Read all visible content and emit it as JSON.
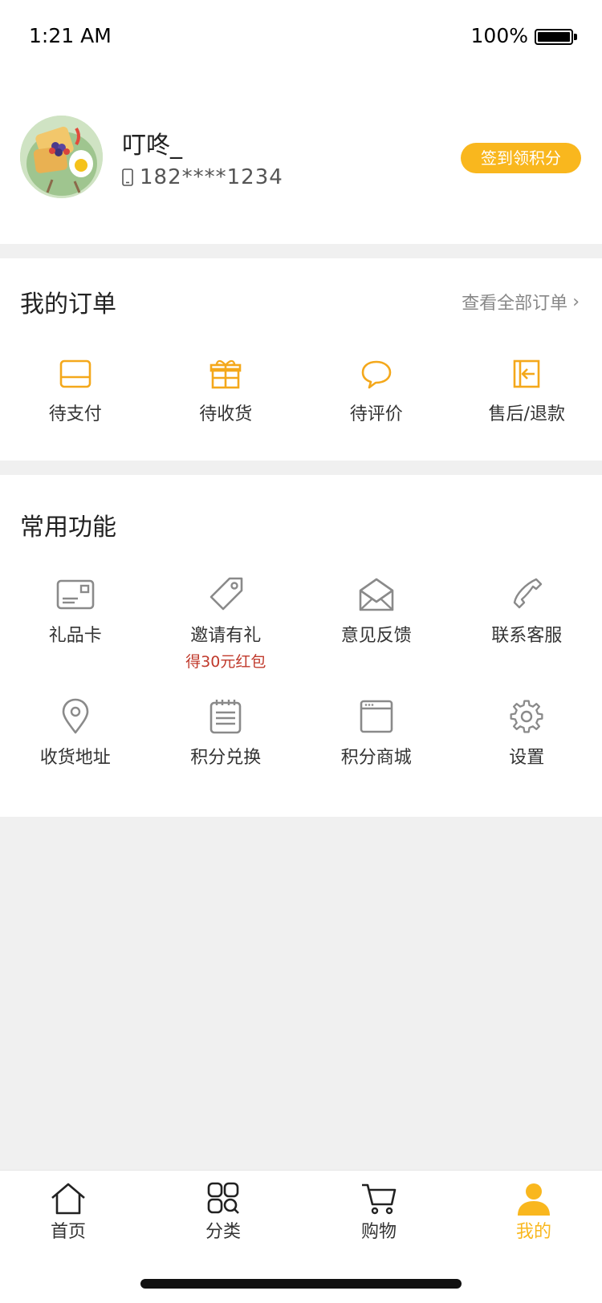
{
  "status_bar": {
    "time": "1:21 AM",
    "battery": "100%"
  },
  "profile": {
    "username": "叮咚_",
    "phone": "182****1234",
    "checkin_label": "签到领积分"
  },
  "orders": {
    "title": "我的订单",
    "view_all": "查看全部订单",
    "items": [
      {
        "label": "待支付",
        "icon": "wallet-icon"
      },
      {
        "label": "待收货",
        "icon": "gift-box-icon"
      },
      {
        "label": "待评价",
        "icon": "chat-bubble-icon"
      },
      {
        "label": "售后/退款",
        "icon": "return-icon"
      }
    ]
  },
  "features": {
    "title": "常用功能",
    "items": [
      {
        "label": "礼品卡",
        "icon": "gift-card-icon"
      },
      {
        "label": "邀请有礼",
        "sub": "得30元红包",
        "icon": "tag-icon"
      },
      {
        "label": "意见反馈",
        "icon": "envelope-icon"
      },
      {
        "label": "联系客服",
        "icon": "phone-icon"
      },
      {
        "label": "收货地址",
        "icon": "location-pin-icon"
      },
      {
        "label": "积分兑换",
        "icon": "notepad-icon"
      },
      {
        "label": "积分商城",
        "icon": "browser-window-icon"
      },
      {
        "label": "设置",
        "icon": "gear-icon"
      }
    ]
  },
  "tabbar": {
    "items": [
      {
        "label": "首页",
        "icon": "home-icon"
      },
      {
        "label": "分类",
        "icon": "category-icon"
      },
      {
        "label": "购物",
        "icon": "cart-icon"
      },
      {
        "label": "我的",
        "icon": "user-icon",
        "active": true
      }
    ]
  },
  "colors": {
    "accent": "#f9b71e",
    "promo_red": "#c0392b",
    "icon_gray": "#8a8a8a"
  }
}
